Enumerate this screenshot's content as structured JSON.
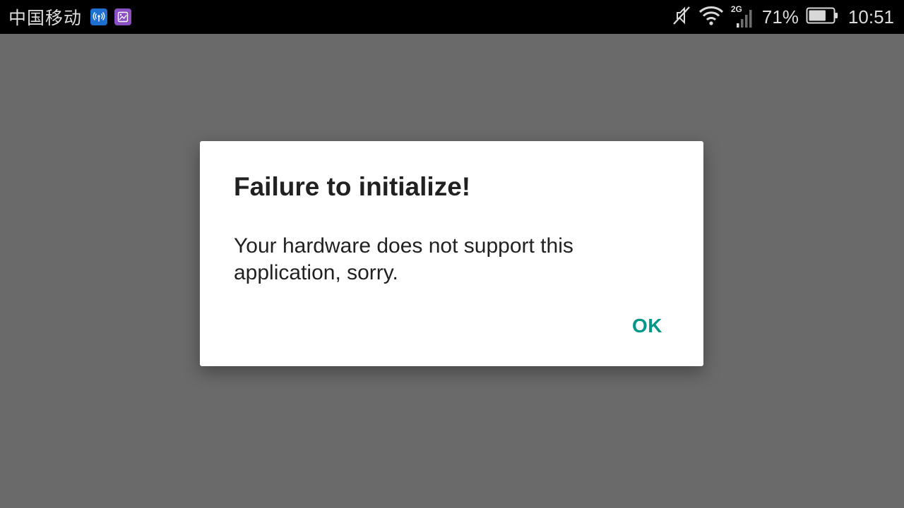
{
  "status_bar": {
    "carrier": "中国移动",
    "network_type": "2G",
    "battery_percent": "71%",
    "battery_level": 0.71,
    "time": "10:51",
    "icons": [
      "wifi-hotspot-app-icon",
      "gallery-app-icon",
      "mute-icon",
      "wifi-icon",
      "signal-icon",
      "battery-icon"
    ]
  },
  "dialog": {
    "title": "Failure to initialize!",
    "message": "Your hardware does not support this application, sorry.",
    "ok_label": "OK"
  },
  "colors": {
    "accent": "#009688",
    "scrim": "#6a6a6a",
    "status_bar": "#000000"
  }
}
